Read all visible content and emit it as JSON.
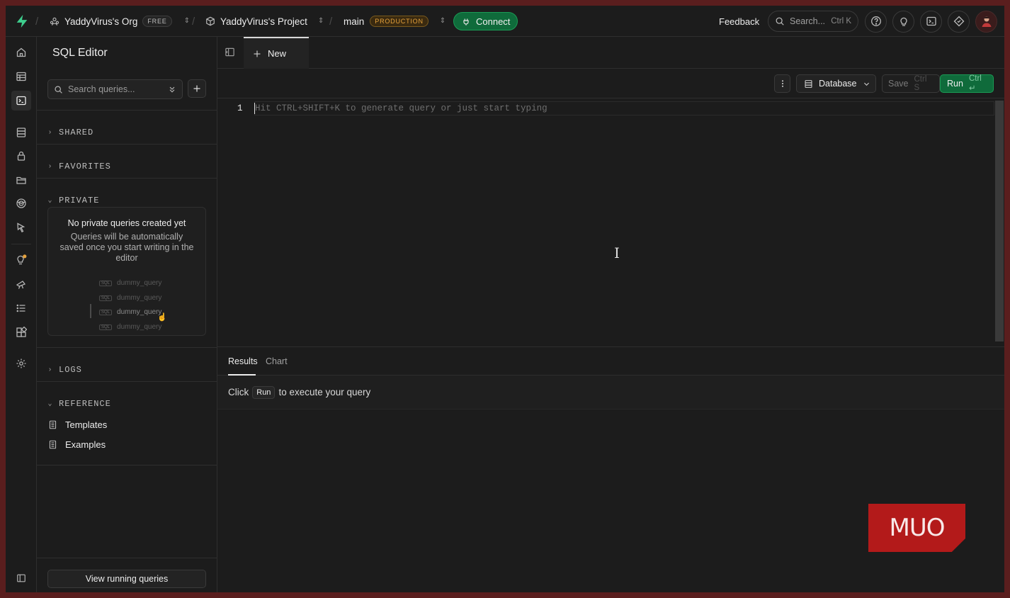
{
  "topbar": {
    "org_name": "YaddyVirus's Org",
    "org_plan": "FREE",
    "project_name": "YaddyVirus's Project",
    "branch_name": "main",
    "branch_env": "PRODUCTION",
    "connect_label": "Connect",
    "feedback_label": "Feedback",
    "search_placeholder": "Search...",
    "search_shortcut": "Ctrl K"
  },
  "sidebar": {
    "title": "SQL Editor",
    "search_placeholder": "Search queries...",
    "sections": {
      "shared": "SHARED",
      "favorites": "FAVORITES",
      "private": "PRIVATE",
      "logs": "LOGS",
      "reference": "REFERENCE"
    },
    "empty": {
      "title": "No private queries created yet",
      "description": "Queries will be automatically saved once you start writing in the editor",
      "dummy_items": [
        "dummy_query",
        "dummy_query",
        "dummy_query",
        "dummy_query"
      ],
      "dummy_tag": "SQL"
    },
    "reference_items": [
      "Templates",
      "Examples"
    ],
    "view_running_label": "View running queries"
  },
  "main": {
    "tab_new_label": "New",
    "toolbar": {
      "database_label": "Database",
      "save_label": "Save",
      "save_shortcut": "Ctrl S",
      "run_label": "Run",
      "run_shortcut": "Ctrl ↵"
    },
    "editor": {
      "line_number": "1",
      "placeholder": "Hit CTRL+SHIFT+K to generate query or just start typing"
    },
    "results": {
      "tabs": [
        "Results",
        "Chart"
      ],
      "message_before": "Click",
      "message_kbd": "Run",
      "message_after": "to execute your query"
    }
  },
  "watermark": "MUO",
  "colors": {
    "accent_green": "#0f6b3b",
    "production_badge": "#e6a23c",
    "watermark_red": "#b31a1a"
  }
}
